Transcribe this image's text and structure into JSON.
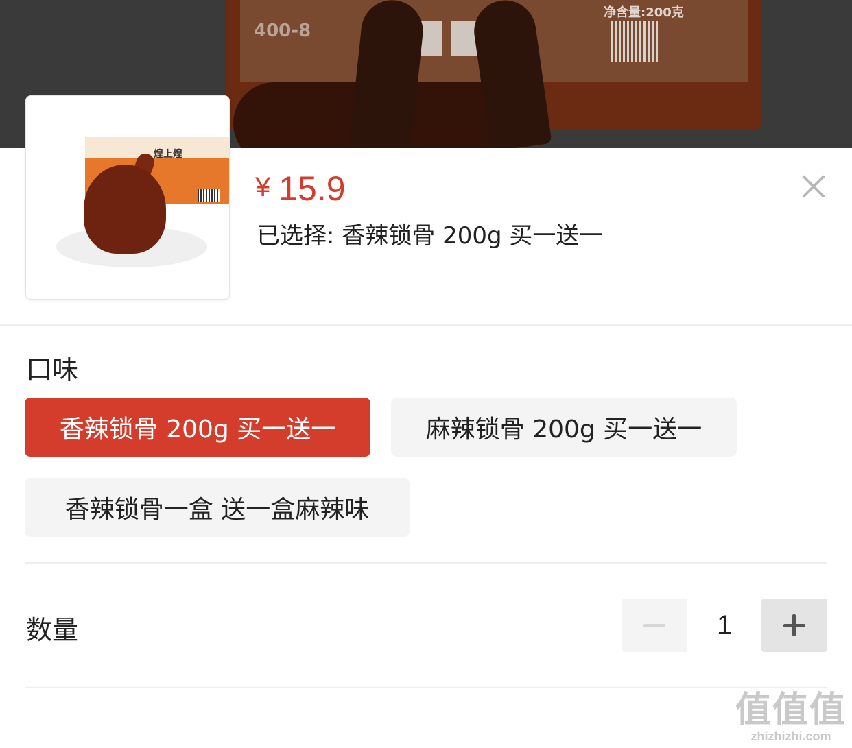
{
  "banner": {
    "hotline": "400-8",
    "net_weight": "净含量:200克"
  },
  "thumbnail": {
    "brand_text": "煌上煌"
  },
  "product": {
    "currency_symbol": "¥",
    "price": "15.9",
    "selected_text": "已选择: 香辣锁骨 200g 买一送一"
  },
  "flavor": {
    "title": "口味",
    "options": [
      {
        "label": "香辣锁骨 200g 买一送一",
        "active": true
      },
      {
        "label": "麻辣锁骨 200g 买一送一",
        "active": false
      },
      {
        "label": "香辣锁骨一盒 送一盒麻辣味",
        "active": false
      }
    ]
  },
  "quantity": {
    "title": "数量",
    "value": "1"
  },
  "watermark": {
    "text": "值值值",
    "site": "zhizhizhi.com"
  },
  "icons": {
    "close": "close-icon",
    "minus": "minus-icon",
    "plus": "plus-icon"
  },
  "colors": {
    "accent": "#d43d2c",
    "chip_bg": "#f4f4f4",
    "text": "#222222",
    "banner_overlay": "#3a3a3a"
  }
}
